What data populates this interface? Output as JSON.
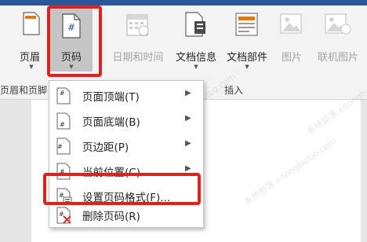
{
  "ribbon": {
    "buttons": {
      "header": {
        "label": "页眉"
      },
      "page_number": {
        "label": "页码",
        "icon_glyph": "#"
      },
      "datetime": {
        "label": "日期和时间"
      },
      "doc_info": {
        "label": "文档信息"
      },
      "doc_parts": {
        "label": "文档部件"
      },
      "picture": {
        "label": "图片"
      },
      "online_picture": {
        "label": "联机图片"
      }
    },
    "groups": {
      "header_footer": "页眉和页脚",
      "insert": "插入"
    }
  },
  "dropdown": {
    "items": [
      {
        "label": "页面顶端(T)",
        "has_submenu": true
      },
      {
        "label": "页面底端(B)",
        "has_submenu": true
      },
      {
        "label": "页边距(P)",
        "has_submenu": true
      },
      {
        "label": "当前位置(C)",
        "has_submenu": true
      },
      {
        "label": "设置页码格式(F)...",
        "has_submenu": false
      },
      {
        "label": "删除页码(R)",
        "has_submenu": false
      }
    ]
  },
  "watermark_text": "系统部落 xitongbuluo.com",
  "colors": {
    "highlight": "#e3211c",
    "titlebar": "#2b579a",
    "ribbon_bg": "#f3f3f3"
  }
}
